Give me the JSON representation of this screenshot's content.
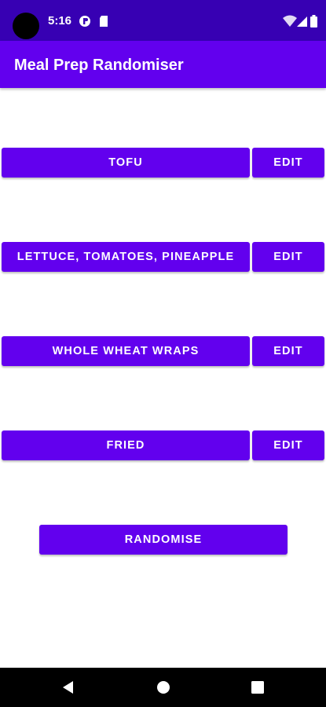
{
  "status_bar": {
    "time": "5:16"
  },
  "app_bar": {
    "title": "Meal Prep Randomiser"
  },
  "meal_rows": [
    {
      "label": "TOFU",
      "edit_label": "EDIT"
    },
    {
      "label": "LETTUCE, TOMATOES, PINEAPPLE",
      "edit_label": "EDIT"
    },
    {
      "label": "WHOLE WHEAT WRAPS",
      "edit_label": "EDIT"
    },
    {
      "label": "FRIED",
      "edit_label": "EDIT"
    }
  ],
  "randomise_button": {
    "label": "RANDOMISE"
  },
  "icons": {
    "status_left": [
      "app-notification-icon",
      "sd-card-icon"
    ],
    "status_right": [
      "wifi-icon",
      "signal-icon",
      "battery-icon"
    ],
    "navigation": [
      "back-icon",
      "home-icon",
      "recents-icon"
    ]
  },
  "colors": {
    "status_bar": "#3700B3",
    "primary": "#6200EE",
    "on_primary": "#FFFFFF",
    "background": "#FFFFFF",
    "nav_bar": "#000000"
  }
}
